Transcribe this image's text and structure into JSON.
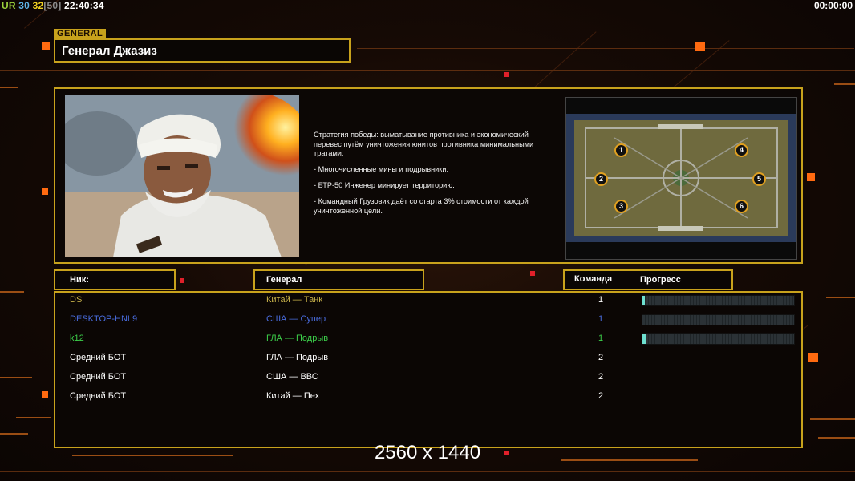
{
  "top_left": {
    "ur_label": "UR",
    "ur_value": "30",
    "fps": "32",
    "fps_max": "[50]",
    "clock": "22:40:34"
  },
  "top_right": {
    "timer": "00:00:00"
  },
  "general_tag": "GENERAL",
  "general_name": "Генерал Джазиз",
  "description": [
    "Стратегия победы: выматывание противника и экономический перевес путём уничтожения юнитов противника минимальными тратами.",
    "- Многочисленные мины и подрывники.",
    "- БТР-50 Инженер минирует территорию.",
    "- Командный Грузовик даёт со старта 3% стоимости от каждой уничтоженной цели."
  ],
  "minimap": {
    "slots": [
      "1",
      "2",
      "3",
      "4",
      "5",
      "6"
    ]
  },
  "columns": {
    "nick": "Ник:",
    "general": "Генерал",
    "team": "Команда",
    "progress": "Прогресс"
  },
  "players": [
    {
      "nick": "DS",
      "general": "Китай — Танк",
      "team": "1",
      "color": "#c8b24a",
      "team_color": "#ffffff",
      "progress": 0.01
    },
    {
      "nick": "DESKTOP-HNL9",
      "general": "США — Супер",
      "team": "1",
      "color": "#4a6de0",
      "team_color": "#4a6de0",
      "progress": 0
    },
    {
      "nick": "k12",
      "general": "ГЛА — Подрыв",
      "team": "1",
      "color": "#3ccf4a",
      "team_color": "#3ccf4a",
      "progress": 0.02
    },
    {
      "nick": "Средний БОТ",
      "general": "ГЛА — Подрыв",
      "team": "2",
      "color": "#ffffff",
      "team_color": "#ffffff",
      "progress": null
    },
    {
      "nick": "Средний БОТ",
      "general": "США — ВВС",
      "team": "2",
      "color": "#ffffff",
      "team_color": "#ffffff",
      "progress": null
    },
    {
      "nick": "Средний БОТ",
      "general": "Китай — Пех",
      "team": "2",
      "color": "#ffffff",
      "team_color": "#ffffff",
      "progress": null
    }
  ],
  "resolution_label": "2560 x 1440",
  "colors": {
    "accent_gold": "#c8a21c",
    "accent_orange": "#ff6a10",
    "ur_color": "#9bd33c",
    "fps_color": "#f0d020",
    "fps_max_color": "#8a8a8a"
  }
}
